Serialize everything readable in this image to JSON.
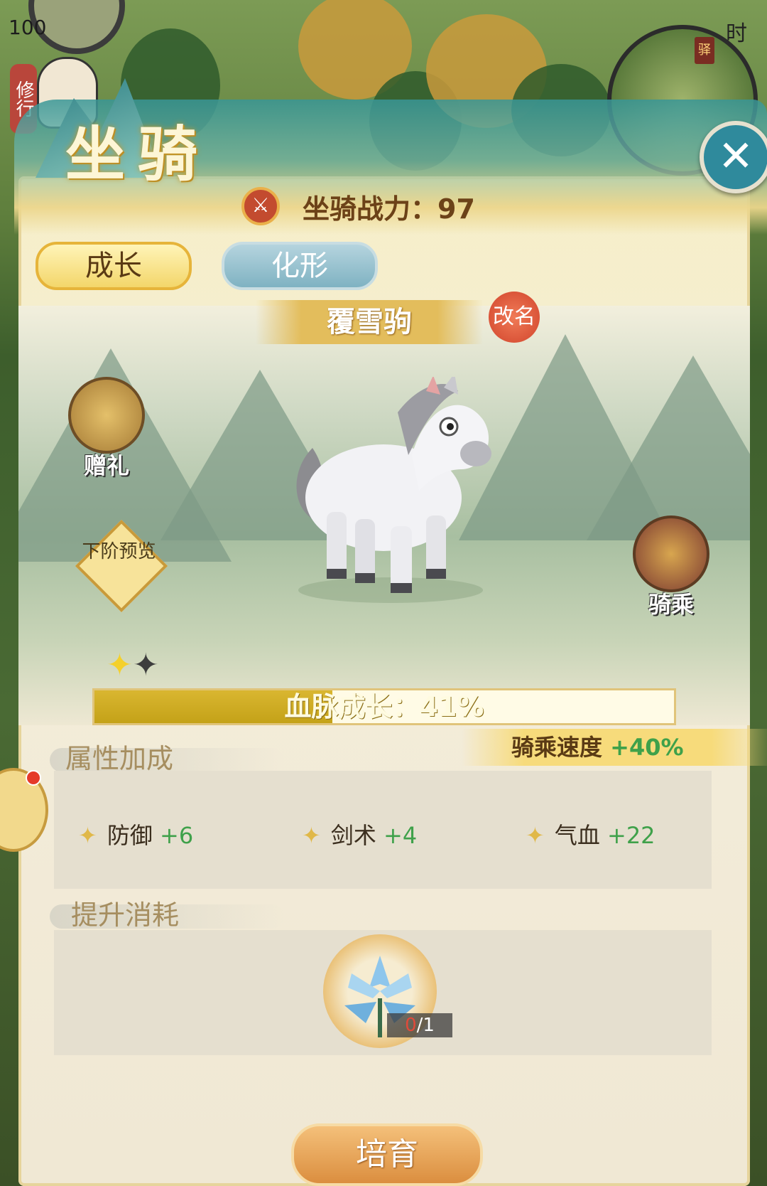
{
  "hud": {
    "level": "100",
    "xiuxing": "修行",
    "time_char": "时",
    "minimap_tag": "驿"
  },
  "panel": {
    "title": "坐骑",
    "power_label": "坐骑战力：97",
    "tabs": [
      {
        "label": "成长",
        "active": true
      },
      {
        "label": "化形",
        "active": false
      }
    ],
    "mount_name": "覆雪驹",
    "rename_label": "改名",
    "gift_label": "赠礼",
    "preview_label": "下阶预览",
    "ride_label": "骑乘",
    "stars": {
      "filled": 1,
      "total": 2
    },
    "bloodline": {
      "label": "血脉成长：41%",
      "progress": 0.41
    },
    "attributes": {
      "title": "属性加成",
      "speed_label": "骑乘速度",
      "speed_value": "+40%",
      "items": [
        {
          "name": "防御",
          "value": "+6"
        },
        {
          "name": "剑术",
          "value": "+4"
        },
        {
          "name": "气血",
          "value": "+22"
        }
      ]
    },
    "cost": {
      "title": "提升消耗",
      "have": "0",
      "need": "/1",
      "item_icon": "blue-lily-icon"
    },
    "cultivate_label": "培育",
    "close_icon": "close-icon"
  },
  "colors": {
    "gold": "#e3bd5c",
    "green_bonus": "#3fa14a",
    "teal": "#2f8a9c"
  }
}
